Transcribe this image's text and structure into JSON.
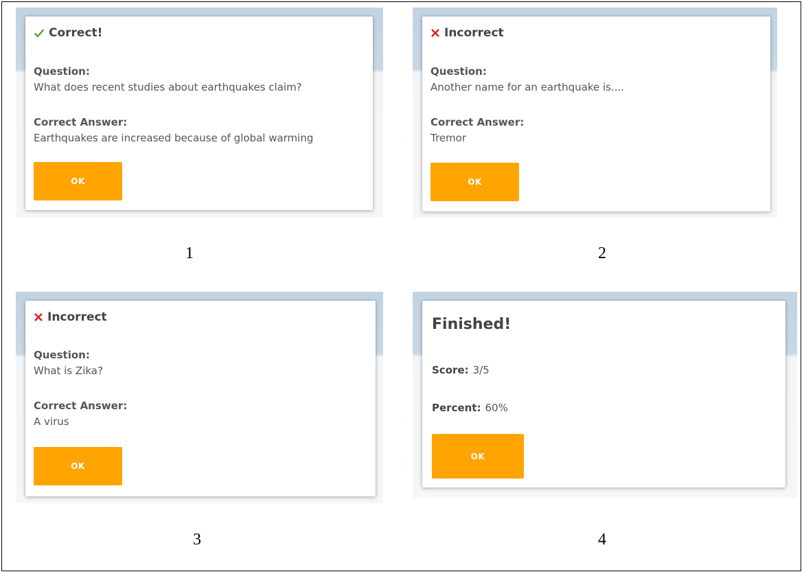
{
  "panels": [
    {
      "status": "Correct!",
      "status_icon": "check-icon",
      "status_color": "#5aa02c",
      "question_label": "Question:",
      "question": "What does recent studies about earthquakes claim?",
      "answer_label": "Correct Answer:",
      "answer": "Earthquakes are increased because of global warming",
      "ok_label": "OK",
      "caption": "1"
    },
    {
      "status": "Incorrect",
      "status_icon": "cross-icon",
      "status_color": "#e01b1b",
      "question_label": "Question:",
      "question": "Another name for an earthquake is....",
      "answer_label": "Correct Answer:",
      "answer": "Tremor",
      "ok_label": "OK",
      "caption": "2"
    },
    {
      "status": "Incorrect",
      "status_icon": "cross-icon",
      "status_color": "#e01b1b",
      "question_label": "Question:",
      "question": "What is Zika?",
      "answer_label": "Correct Answer:",
      "answer": "A virus",
      "ok_label": "OK",
      "caption": "3"
    }
  ],
  "finished": {
    "title": "Finished!",
    "score_label": "Score:",
    "score_value": "3/5",
    "percent_label": "Percent:",
    "percent_value": "60%",
    "ok_label": "OK",
    "caption": "4"
  },
  "colors": {
    "button": "#ffa400",
    "header_band": "#c2d3e1"
  }
}
